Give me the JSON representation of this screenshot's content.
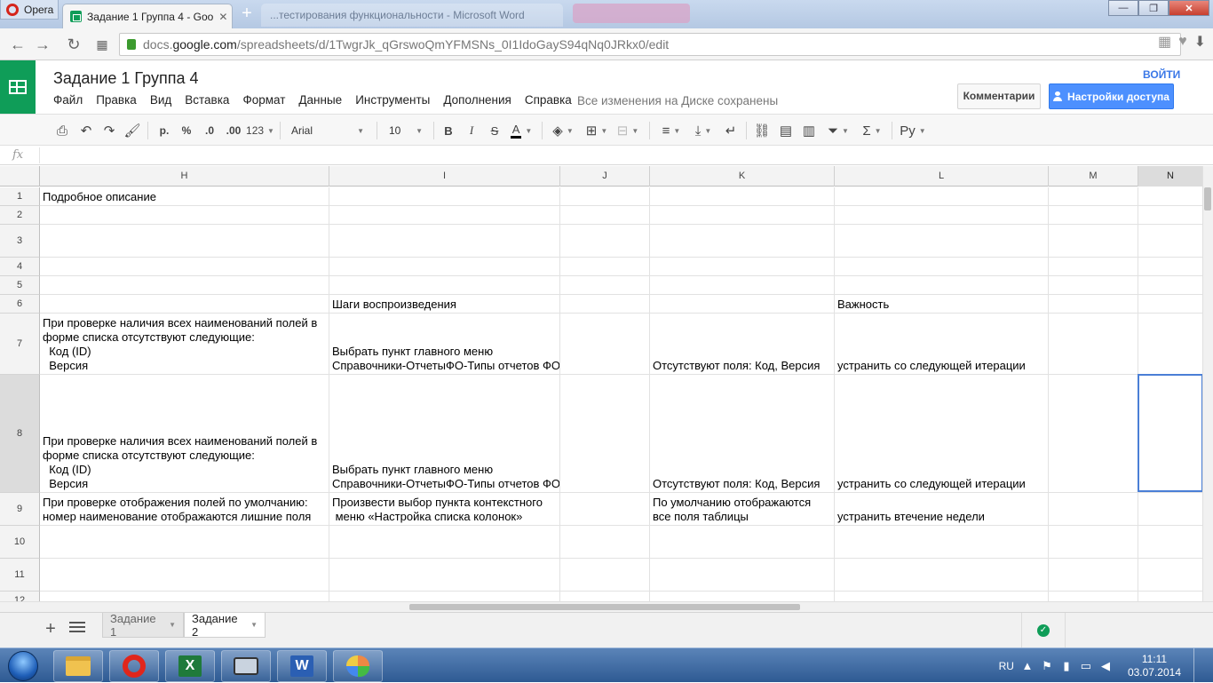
{
  "browser": {
    "menu_label": "Opera",
    "active_tab_title": "Задание 1 Группа 4 - Goo",
    "inactive_tab_title": "...тестирования функциональности - Microsoft Word",
    "new_tab": "+",
    "url_prefix": "docs.",
    "url_domain": "google.com",
    "url_path": "/spreadsheets/d/1TwgrJk_qGrswoQmYFMSNs_0I1IdoGayS94qNq0JRkx0/edit"
  },
  "doc": {
    "title": "Задание 1 Группа 4",
    "menu": [
      "Файл",
      "Правка",
      "Вид",
      "Вставка",
      "Формат",
      "Данные",
      "Инструменты",
      "Дополнения",
      "Справка"
    ],
    "save_status": "Все изменения на Диске сохранены",
    "signin": "ВОЙТИ",
    "comments_label": "Комментарии",
    "share_label": "Настройки доступа"
  },
  "toolbar": {
    "currency": "р.",
    "percent": "%",
    "dec_less": ".0",
    "dec_more": ".00",
    "number_format": "123",
    "font": "Arial",
    "size": "10",
    "bold": "B",
    "italic": "I",
    "strike": "S",
    "text_color": "A",
    "input_tools": "Ру"
  },
  "formula": {
    "fx": "fx"
  },
  "grid": {
    "columns": [
      {
        "label": "H",
        "selected": false
      },
      {
        "label": "I",
        "selected": false
      },
      {
        "label": "J",
        "selected": false
      },
      {
        "label": "K",
        "selected": false
      },
      {
        "label": "L",
        "selected": false
      },
      {
        "label": "M",
        "selected": false
      },
      {
        "label": "N",
        "selected": true
      }
    ],
    "rows": [
      {
        "num": "1",
        "cells": [
          "Подробное описание",
          "",
          "",
          "",
          "",
          "",
          ""
        ]
      },
      {
        "num": "2",
        "cells": [
          "",
          "",
          "",
          "",
          "",
          "",
          ""
        ]
      },
      {
        "num": "3",
        "cells": [
          "",
          "",
          "",
          "",
          "",
          "",
          ""
        ]
      },
      {
        "num": "4",
        "cells": [
          "",
          "",
          "",
          "",
          "",
          "",
          ""
        ]
      },
      {
        "num": "5",
        "cells": [
          "",
          "",
          "",
          "",
          "",
          "",
          ""
        ]
      },
      {
        "num": "6",
        "cells": [
          "",
          "Шаги воспроизведения",
          "",
          "",
          "Важность",
          "",
          ""
        ]
      },
      {
        "num": "7",
        "cells": [
          "При проверке наличия всех наименований полей в\nформе списка отсутствуют следующие:\n  Код (ID)\n  Версия",
          "Выбрать пункт главного меню\nСправочники-ОтчетыФО-Типы отчетов ФО",
          "",
          "Отсутствуют поля: Код, Версия",
          "устранить со следующей итерации",
          "",
          ""
        ]
      },
      {
        "num": "8",
        "cells": [
          "При проверке наличия всех наименований полей в\nформе списка отсутствуют следующие:\n  Код (ID)\n  Версия",
          "Выбрать пункт главного меню\nСправочники-ОтчетыФО-Типы отчетов ФО",
          "",
          "Отсутствуют поля: Код, Версия",
          "устранить со следующей итерации",
          "",
          ""
        ]
      },
      {
        "num": "9",
        "cells": [
          "При проверке отображения полей по умолчанию:\nномер наименование отображаются лишние поля",
          "Произвести выбор пункта контекстного\n меню «Настройка списка колонок»",
          "",
          "По умолчанию отображаются\nвсе поля таблицы",
          "устранить втечение недели",
          "",
          ""
        ]
      },
      {
        "num": "10",
        "cells": [
          "",
          "",
          "",
          "",
          "",
          "",
          ""
        ]
      },
      {
        "num": "11",
        "cells": [
          "",
          "",
          "",
          "",
          "",
          "",
          ""
        ]
      },
      {
        "num": "12",
        "cells": [
          "",
          "",
          "",
          "",
          "",
          "",
          ""
        ]
      }
    ]
  },
  "sheets": {
    "add": "+",
    "tabs": [
      {
        "label": "Задание 1",
        "active": false
      },
      {
        "label": "Задание 2",
        "active": true
      }
    ]
  },
  "taskbar": {
    "lang": "RU",
    "time": "11:11",
    "date": "03.07.2014",
    "excel_letter": "X",
    "word_letter": "W"
  }
}
